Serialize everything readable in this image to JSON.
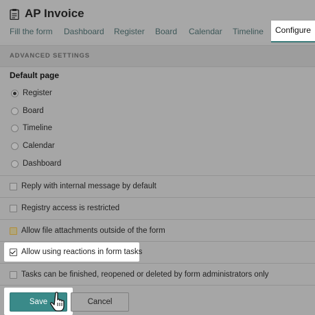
{
  "header": {
    "title": "AP Invoice",
    "title_icon": "clipboard-icon",
    "tabs": [
      {
        "label": "Fill the form"
      },
      {
        "label": "Dashboard"
      },
      {
        "label": "Register"
      },
      {
        "label": "Board"
      },
      {
        "label": "Calendar"
      },
      {
        "label": "Timeline"
      },
      {
        "label": "Configure",
        "active": true
      }
    ]
  },
  "section": {
    "heading": "ADVANCED SETTINGS"
  },
  "default_page": {
    "label": "Default page",
    "selected": "Register",
    "options": [
      {
        "label": "Register"
      },
      {
        "label": "Board"
      },
      {
        "label": "Timeline"
      },
      {
        "label": "Calendar"
      },
      {
        "label": "Dashboard"
      }
    ]
  },
  "options": [
    {
      "label": "Reply with internal message by default",
      "checked": false
    },
    {
      "label": "Registry access is restricted",
      "checked": false
    },
    {
      "label": "Allow file attachments outside of the form",
      "checked": false
    },
    {
      "label": "Allow using reactions in form tasks",
      "checked": true
    },
    {
      "label": "Tasks can be finished, reopened or deleted by form administrators only",
      "checked": false
    }
  ],
  "actions": {
    "save_label": "Save",
    "cancel_label": "Cancel"
  },
  "colors": {
    "accent": "#3a8a89",
    "overlay": "#a6a6a6"
  }
}
